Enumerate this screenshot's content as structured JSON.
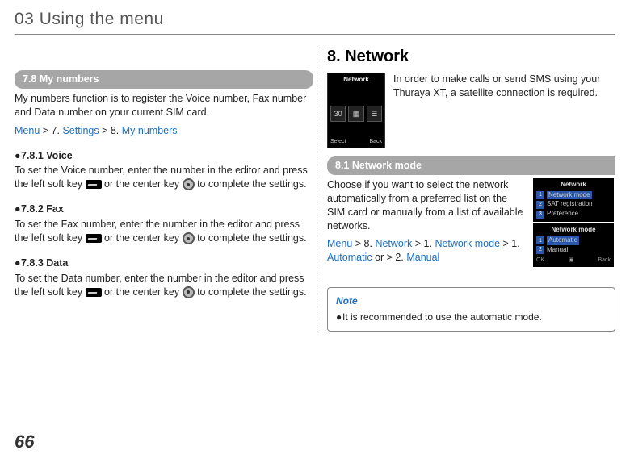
{
  "chapter": "03 Using the menu",
  "pageNumber": "66",
  "left": {
    "sectionBar": "7.8  My numbers",
    "intro": "My numbers function is to register the Voice number, Fax number and Data number on your current SIM card.",
    "breadcrumb": {
      "p1": "Menu",
      "p2": " > 7. ",
      "p3": "Settings",
      "p4": " > 8. ",
      "p5": "My numbers"
    },
    "sub1": {
      "h": "7.8.1  Voice",
      "t1": "To set the Voice number, enter the number in the editor and press the left soft key ",
      "t2": " or the center key ",
      "t3": " to complete the settings."
    },
    "sub2": {
      "h": "7.8.2  Fax",
      "t1": "To set the Fax number, enter the number in the editor and press the left soft key ",
      "t2": " or the center key ",
      "t3": " to complete the settings."
    },
    "sub3": {
      "h": "7.8.3  Data",
      "t1": "To set the Data number, enter the number in the editor and press the left soft key ",
      "t2": " or the center key ",
      "t3": " to complete the settings."
    }
  },
  "right": {
    "heading": "8. Network",
    "introText": "In order to make calls or send SMS using your Thuraya XT, a satellite connection is required.",
    "screen1": {
      "title": "Network",
      "ic1": "30",
      "ic2": "▦",
      "ic3": "☰",
      "bL": "Select",
      "bR": "Back"
    },
    "sectionBar": "8.1  Network mode",
    "body": "Choose if you want to select the network automatically from a preferred list on the SIM card or manually from a list of available networks.",
    "breadcrumb": {
      "p1": "Menu",
      "p2": " > 8. ",
      "p3": "Network",
      "p4": " > 1. ",
      "p5": "Network mode",
      "p6": " > 1. ",
      "p7": "Automatic",
      "p8": " or > 2. ",
      "p9": "Manual"
    },
    "miniA": {
      "title": "Network",
      "r1": "Network mode",
      "r2": "SAT registration",
      "r3": "Preference"
    },
    "miniB": {
      "title": "Network mode",
      "r1": "Automatic",
      "r2": "Manual",
      "bL": "OK",
      "bR": "Back"
    },
    "note": {
      "title": "Note",
      "item": "It is recommended to use the automatic mode."
    }
  }
}
